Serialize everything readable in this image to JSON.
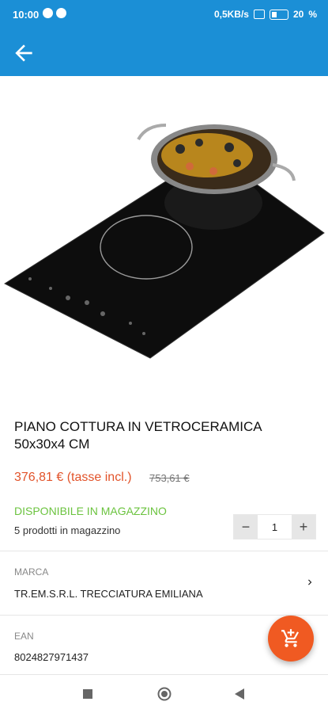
{
  "status": {
    "time": "10:00",
    "network": "0,5KB/s",
    "battery": "20"
  },
  "product": {
    "title": "PIANO COTTURA IN VETROCERAMICA 50x30x4 CM",
    "price": "376,81 € (tasse incl.)",
    "old_price": "753,61 €",
    "availability": "DISPONIBILE IN MAGAZZINO",
    "stock_note": "5 prodotti in magazzino",
    "quantity": "1",
    "brand_label": "MARCA",
    "brand_value": "TR.EM.S.R.L. TRECCIATURA EMILIANA",
    "ean_label": "EAN",
    "ean_value": "8024827971437"
  },
  "qty_buttons": {
    "minus": "−",
    "plus": "+"
  },
  "colors": {
    "appbar": "#1b8fd6",
    "price": "#e2532a",
    "stock": "#6bc33f",
    "fab": "#f05a22"
  },
  "icons": [
    "arrow-left-icon",
    "chevron-right-icon",
    "add-to-cart-icon",
    "nav-square-icon",
    "nav-circle-icon",
    "nav-triangle-icon"
  ]
}
